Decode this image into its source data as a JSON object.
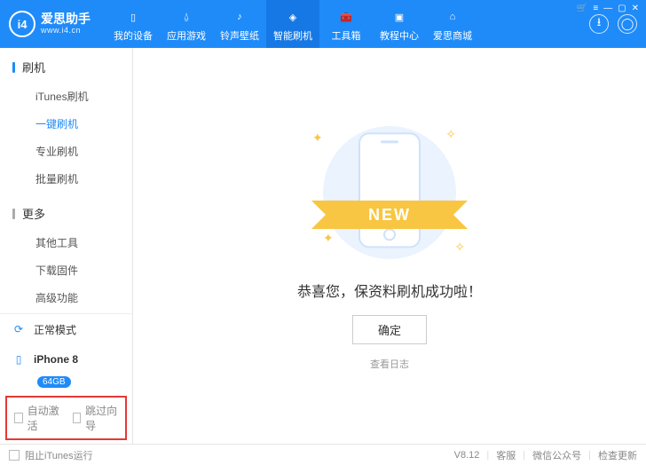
{
  "header": {
    "logo_text": "爱思助手",
    "logo_url": "www.i4.cn",
    "logo_abbrev": "i4",
    "nav": [
      {
        "label": "我的设备",
        "icon": "phone-icon"
      },
      {
        "label": "应用游戏",
        "icon": "apps-icon"
      },
      {
        "label": "铃声壁纸",
        "icon": "music-icon"
      },
      {
        "label": "智能刷机",
        "icon": "flash-icon",
        "active": true
      },
      {
        "label": "工具箱",
        "icon": "toolbox-icon"
      },
      {
        "label": "教程中心",
        "icon": "tutorial-icon"
      },
      {
        "label": "爱思商城",
        "icon": "shop-icon"
      }
    ],
    "window_controls": [
      "🛒",
      "≡",
      "—",
      "▢",
      "✕"
    ]
  },
  "sidebar": {
    "section1_title": "刷机",
    "items1": [
      {
        "label": "iTunes刷机"
      },
      {
        "label": "一键刷机",
        "active": true
      },
      {
        "label": "专业刷机"
      },
      {
        "label": "批量刷机"
      }
    ],
    "section2_title": "更多",
    "items2": [
      {
        "label": "其他工具"
      },
      {
        "label": "下载固件"
      },
      {
        "label": "高级功能"
      }
    ],
    "mode_label": "正常模式",
    "device_name": "iPhone 8",
    "device_badge": "64GB",
    "checkbox1": "自动激活",
    "checkbox2": "跳过向导"
  },
  "main": {
    "ribbon": "NEW",
    "success_text": "恭喜您，保资料刷机成功啦！",
    "ok_button": "确定",
    "log_link": "查看日志"
  },
  "footer": {
    "block_itunes": "阻止iTunes运行",
    "version": "V8.12",
    "link1": "客服",
    "link2": "微信公众号",
    "link3": "检查更新"
  }
}
